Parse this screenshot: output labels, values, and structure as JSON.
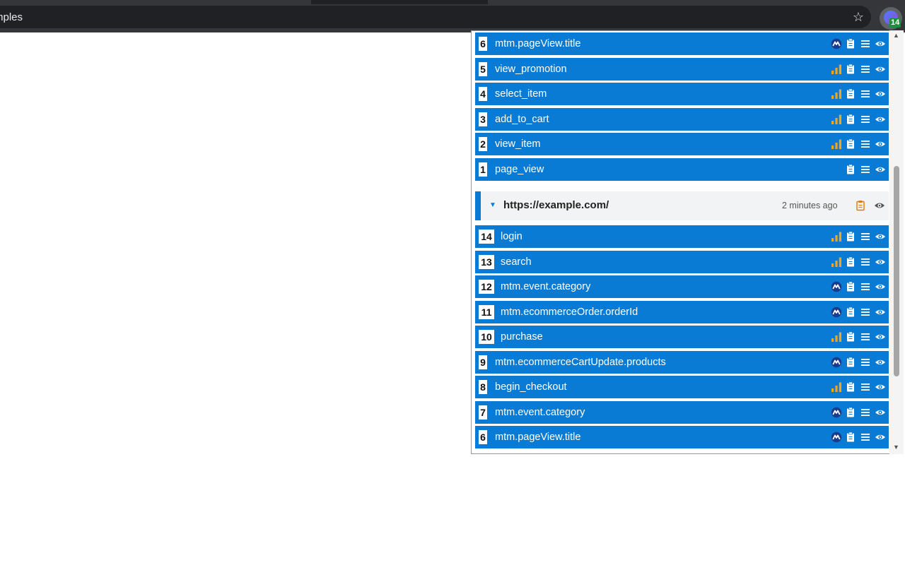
{
  "browser": {
    "address_text": "mples",
    "star_icon": "star-icon",
    "extension_badge": "14"
  },
  "popup": {
    "events_top": [
      {
        "num": "6",
        "name": "mtm.pageView.title",
        "source": "matomo"
      },
      {
        "num": "5",
        "name": "view_promotion",
        "source": "analytics"
      },
      {
        "num": "4",
        "name": "select_item",
        "source": "analytics"
      },
      {
        "num": "3",
        "name": "add_to_cart",
        "source": "analytics"
      },
      {
        "num": "2",
        "name": "view_item",
        "source": "analytics"
      },
      {
        "num": "1",
        "name": "page_view",
        "source": "none"
      }
    ],
    "group": {
      "url": "https://example.com/",
      "time": "2 minutes ago"
    },
    "events_bottom": [
      {
        "num": "14",
        "name": "login",
        "source": "analytics"
      },
      {
        "num": "13",
        "name": "search",
        "source": "analytics"
      },
      {
        "num": "12",
        "name": "mtm.event.category",
        "source": "matomo"
      },
      {
        "num": "11",
        "name": "mtm.ecommerceOrder.orderId",
        "source": "matomo"
      },
      {
        "num": "10",
        "name": "purchase",
        "source": "analytics"
      },
      {
        "num": "9",
        "name": "mtm.ecommerceCartUpdate.products",
        "source": "matomo"
      },
      {
        "num": "8",
        "name": "begin_checkout",
        "source": "analytics"
      },
      {
        "num": "7",
        "name": "mtm.event.category",
        "source": "matomo"
      },
      {
        "num": "6",
        "name": "mtm.pageView.title",
        "source": "matomo"
      }
    ],
    "colors": {
      "event_bg": "#0a7bd4",
      "analytics_icon": "#f4a51c",
      "matomo_icon_bg": "#1a3a8c"
    }
  }
}
